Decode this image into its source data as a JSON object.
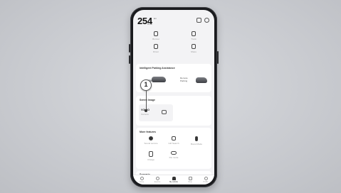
{
  "status": {
    "range_value": "254",
    "range_unit": "km",
    "range_sub": "HVM"
  },
  "controls": [
    {
      "label": "Bonnet",
      "icon": "car-door-icon"
    },
    {
      "label": "Trunk",
      "icon": "trunk-icon"
    },
    {
      "label": "Driver",
      "icon": "door-icon"
    },
    {
      "label": "Share",
      "icon": "share-icon"
    }
  ],
  "parking": {
    "title": "Intelligent Parking Assistance",
    "remote_label": "Remote Parking"
  },
  "sentry": {
    "title": "Sentry Image",
    "value": "VOLVO",
    "sub": "Camera"
  },
  "callout_number": "1",
  "more": {
    "title": "More features",
    "items": [
      {
        "label": "Sound service",
        "icon": "speaker-icon"
      },
      {
        "label": "Gift Search",
        "icon": "gift-icon"
      },
      {
        "label": "Boost Mode",
        "icon": "battery-icon"
      },
      {
        "label": "Charge",
        "icon": "charger-icon"
      },
      {
        "label": "Pet mode",
        "icon": "pet-icon"
      }
    ]
  },
  "scenario_title": "Scenario",
  "tabs": [
    {
      "label": "Home",
      "active": false
    },
    {
      "label": "Explore",
      "active": false
    },
    {
      "label": "My vehicle",
      "active": true
    },
    {
      "label": "Shop",
      "active": false
    },
    {
      "label": "Profile",
      "active": false
    }
  ]
}
